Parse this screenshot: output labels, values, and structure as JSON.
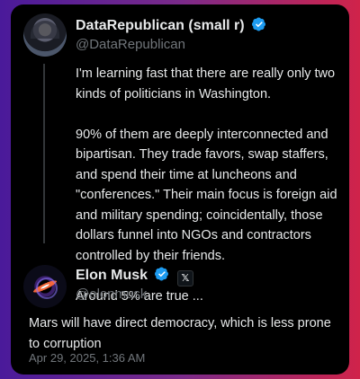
{
  "tweet1": {
    "display_name": "DataRepublican (small r)",
    "handle": "@DataRepublican",
    "text": "I'm learning fast that there are really only two kinds of politicians in Washington.\n\n90% of them are deeply interconnected and bipartisan. They trade favors, swap staffers, and spend their time at luncheons and \"conferences.\" Their main focus is foreign aid and military spending; coincidentally, those dollars funnel into NGOs and contractors controlled by their friends.\n\nAround 5% are true ..."
  },
  "tweet2": {
    "display_name": "Elon Musk",
    "handle": "@elonmusk",
    "text": "Mars will have direct democracy, which is less prone to corruption",
    "timestamp": "Apr 29, 2025, 1:36 AM"
  },
  "icons": {
    "verified": "verified-badge-icon",
    "x_badge": "x-affiliation-icon",
    "x_badge_glyph": "𝕏"
  },
  "colors": {
    "verified_blue": "#1d9bf0",
    "text_primary": "#e7e9ea",
    "text_secondary": "#71767b",
    "card_bg": "#000000"
  }
}
